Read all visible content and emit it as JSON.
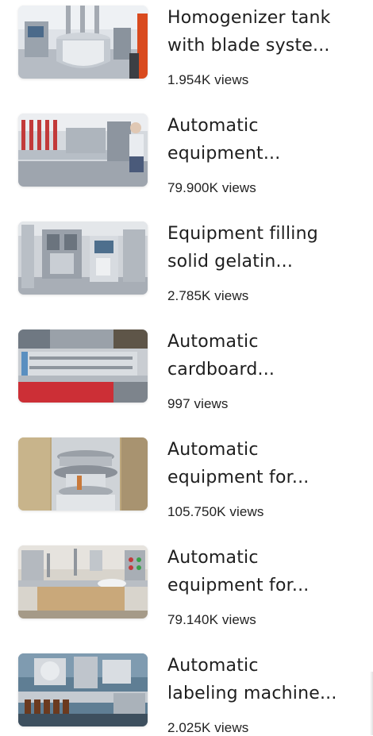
{
  "videos": [
    {
      "title_line1": "Homogenizer tank",
      "title_line2": "with blade syste...",
      "views": "1.954K views",
      "thumb_icon": "homogenizer-tank-photo",
      "accent": "#c9ccd2"
    },
    {
      "title_line1": "Automatic",
      "title_line2": "equipment...",
      "views": "79.900K views",
      "thumb_icon": "automatic-line-photo",
      "accent": "#b9bdc4"
    },
    {
      "title_line1": "Equipment filling",
      "title_line2": "solid gelatin...",
      "views": "2.785K views",
      "thumb_icon": "capsule-filler-photo",
      "accent": "#a9adb4"
    },
    {
      "title_line1": "Automatic",
      "title_line2": "cardboard...",
      "views": "997 views",
      "thumb_icon": "cartoner-photo",
      "accent": "#9aa0a8"
    },
    {
      "title_line1": "Automatic",
      "title_line2": "equipment for...",
      "views": "105.750K views",
      "thumb_icon": "tablet-press-photo",
      "accent": "#b8a27a"
    },
    {
      "title_line1": "Automatic",
      "title_line2": "equipment for...",
      "views": "79.140K views",
      "thumb_icon": "bottle-line-photo",
      "accent": "#c7b89a"
    },
    {
      "title_line1": "Automatic",
      "title_line2": "labeling machine...",
      "views": "2.025K views",
      "thumb_icon": "labeling-machine-photo",
      "accent": "#6b8aa0"
    }
  ]
}
